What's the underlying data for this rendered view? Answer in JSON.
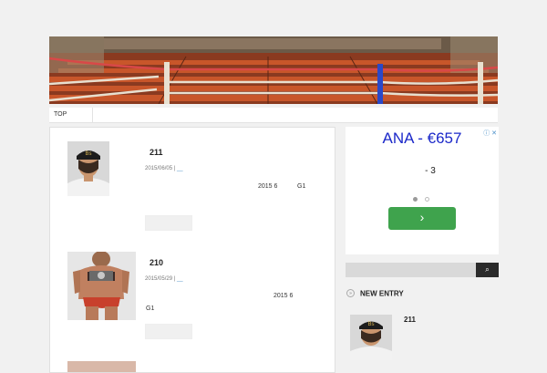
{
  "nav": {
    "items": [
      {
        "label": "TOP"
      }
    ]
  },
  "posts": [
    {
      "title": "211",
      "date": "2015/06/05",
      "separator": " | ",
      "category": "__",
      "excerpt_a": "2015 6",
      "excerpt_b": "G1",
      "thumb_icon": "wrestler-portrait"
    },
    {
      "title": "210",
      "date": "2015/05/29",
      "separator": " | ",
      "category": "__",
      "excerpt_a": "2015 6",
      "excerpt_b": "G1",
      "thumb_icon": "wrestler-belt-photo"
    }
  ],
  "ad": {
    "headline": "ANA    -   €657",
    "sub": "-   3",
    "cta_icon": "chevron-right-icon",
    "cta_glyph": "›",
    "badge": "ⓘ ✕"
  },
  "search": {
    "placeholder": "",
    "value": "",
    "button_icon": "search-icon",
    "button_glyph": "⌕"
  },
  "new_entry": {
    "title": "NEW ENTRY",
    "icon_glyph": "»",
    "items": [
      {
        "title": "211"
      }
    ]
  },
  "colors": {
    "ad_headline": "#1b28c9",
    "cta": "#3fa34d",
    "category_link": "#4a90c8"
  }
}
